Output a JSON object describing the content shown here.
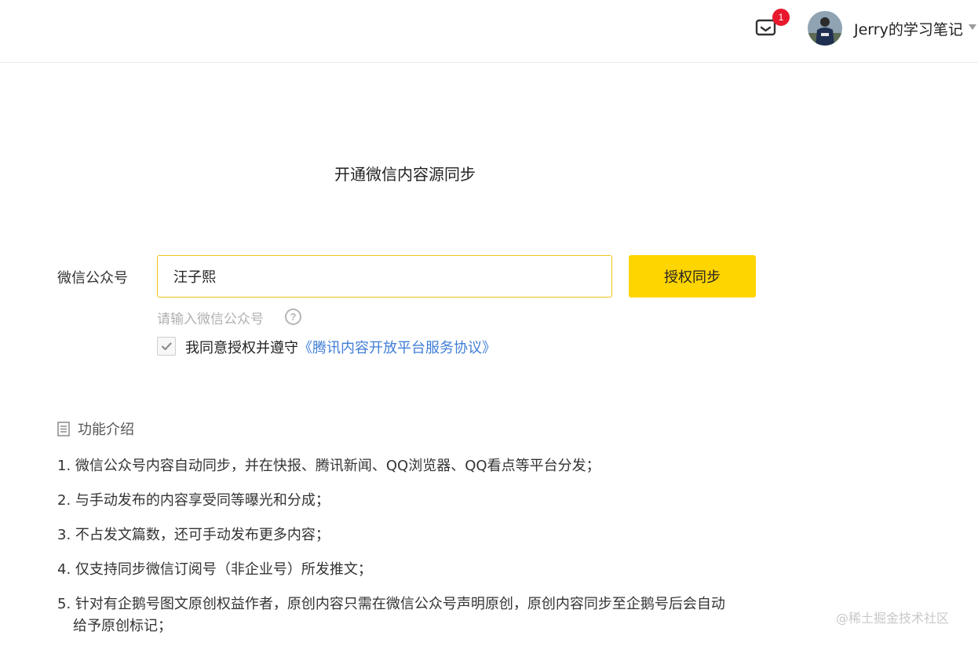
{
  "header": {
    "notification_count": "1",
    "username": "Jerry的学习笔记"
  },
  "page_title": "开通微信内容源同步",
  "form": {
    "account_label": "微信公众号",
    "account_value": "汪子熙",
    "auth_button": "授权同步",
    "hint": "请输入微信公众号",
    "help_icon": "?",
    "agree_prefix": "我同意授权并遵守",
    "agreement_link": "《腾讯内容开放平台服务协议》",
    "agreed": true
  },
  "features": {
    "title": "功能介绍",
    "items": [
      "1. 微信公众号内容自动同步，并在快报、腾讯新闻、QQ浏览器、QQ看点等平台分发；",
      "2. 与手动发布的内容享受同等曝光和分成；",
      "3. 不占发文篇数，还可手动发布更多内容；",
      "4. 仅支持同步微信订阅号（非企业号）所发推文；",
      "5. 针对有企鹅号图文原创权益作者，原创内容只需在微信公众号声明原创，原创内容同步至企鹅号后会自动",
      "给予原创标记；"
    ]
  },
  "watermark": "@稀土掘金技术社区",
  "colors": {
    "accent_yellow": "#ffd500",
    "input_border": "#f0c419",
    "link_blue": "#3f7ed6",
    "badge_red": "#e8192d"
  }
}
